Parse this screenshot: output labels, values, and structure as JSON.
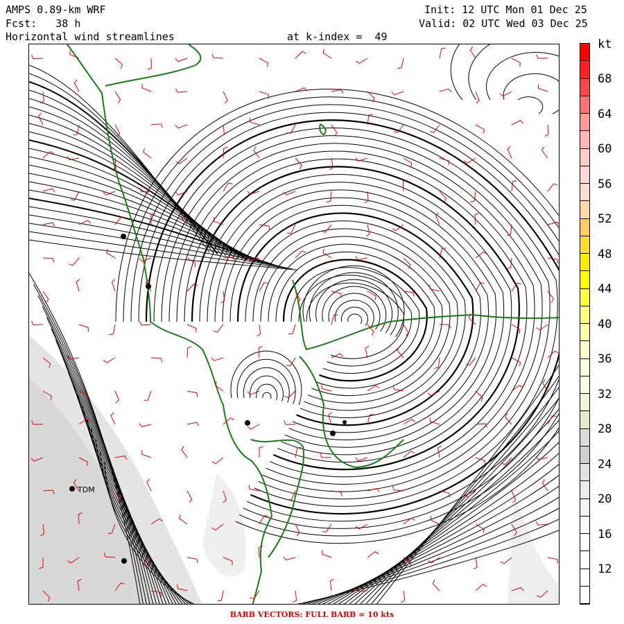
{
  "header": {
    "left_line1": "AMPS 0.89-km WRF",
    "left_line2": "Fcst:   38 h",
    "left_line3": "Horizontal wind streamlines",
    "center_line3": "at k-index =  49",
    "right_line1": "Init: 12 UTC Mon 01 Dec 25",
    "right_line2": "Valid: 02 UTC Wed 03 Dec 25"
  },
  "map": {
    "station_label": "TDM",
    "colors": {
      "streamline": "#000000",
      "coastline": "#1a7a1a",
      "barb": "#e00000",
      "terrain": "#d6d6d6"
    }
  },
  "colorbar": {
    "unit": "kt",
    "labels": [
      "68",
      "64",
      "60",
      "56",
      "52",
      "48",
      "44",
      "40",
      "36",
      "32",
      "28",
      "24",
      "20",
      "16",
      "12"
    ],
    "colors": [
      "#ff0000",
      "#ff2020",
      "#ff4848",
      "#ff7070",
      "#ff9898",
      "#ffb8b8",
      "#ffcccc",
      "#ffd8d8",
      "#ffe0d0",
      "#ffd8a8",
      "#ffcc66",
      "#ffdd33",
      "#ffee00",
      "#ffff00",
      "#ffff40",
      "#ffff80",
      "#ffffa8",
      "#ffffc8",
      "#ffffe0",
      "#fbfbe8",
      "#f4f4dc",
      "#eaeacc",
      "#dcdcdc",
      "#cfcfcf",
      "#e2e2e2",
      "#ececec",
      "#f4f4f4",
      "#fafafa",
      "#ffffff",
      "#ffffff",
      "#ffffff",
      "#ffffff"
    ]
  },
  "footer": {
    "text": "BARB VECTORS:  FULL BARB = 10 kts"
  }
}
